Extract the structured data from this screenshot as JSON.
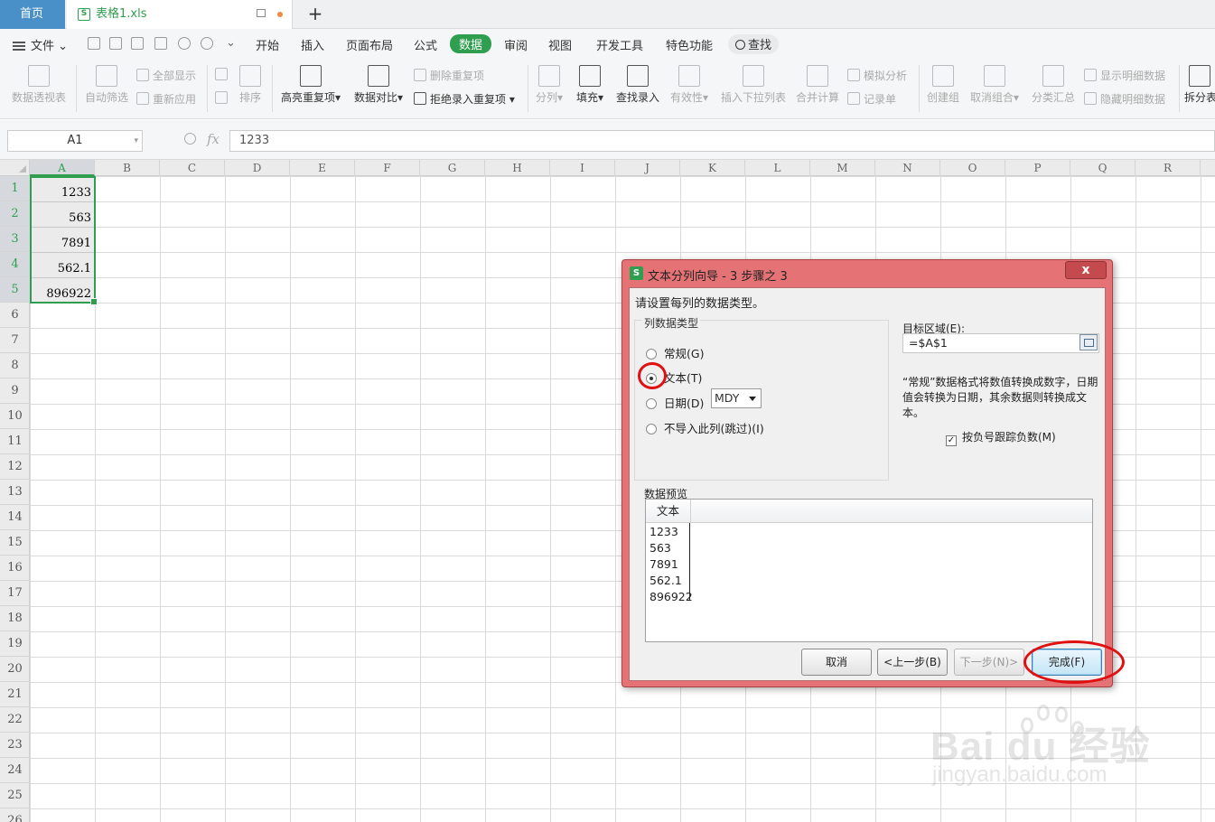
{
  "tabs": {
    "home": "首页",
    "doc": "表格1.xls",
    "add": "+"
  },
  "menu": {
    "file": "文件",
    "items": [
      "开始",
      "插入",
      "页面布局",
      "公式",
      "数据",
      "审阅",
      "视图",
      "开发工具",
      "特色功能"
    ],
    "active": "数据",
    "search": "查找"
  },
  "ribbon": {
    "pivot": "数据透视表",
    "autofilter": "自动筛选",
    "show_all": "全部显示",
    "reapply": "重新应用",
    "sort": "排序",
    "highlight_dup": "高亮重复项",
    "compare": "数据对比",
    "remove_dup": "删除重复项",
    "reject_dup": "拒绝录入重复项",
    "split": "分列",
    "fill": "填充",
    "lookup": "查找录入",
    "validity": "有效性",
    "dropdown": "插入下拉列表",
    "consolidate": "合并计算",
    "simulate": "模拟分析",
    "record": "记录单",
    "group": "创建组",
    "ungroup": "取消组合",
    "subtotal": "分类汇总",
    "show_detail": "显示明细数据",
    "hide_detail": "隐藏明细数据",
    "split_table": "拆分表"
  },
  "formula_bar": {
    "cell_ref": "A1",
    "fx": "fx",
    "value": "1233"
  },
  "sheet": {
    "columns": [
      "A",
      "B",
      "C",
      "D",
      "E",
      "F",
      "G",
      "H",
      "I",
      "J",
      "K",
      "L",
      "M",
      "N",
      "O",
      "P",
      "Q",
      "R"
    ],
    "rows": [
      "1",
      "2",
      "3",
      "4",
      "5",
      "6",
      "7",
      "8",
      "9",
      "10",
      "11",
      "12",
      "13",
      "14",
      "15",
      "16",
      "17",
      "18",
      "19",
      "20",
      "21",
      "22",
      "23",
      "24",
      "25",
      "26"
    ],
    "cells_A": [
      "1233",
      "563",
      "7891",
      "562.1",
      "896922"
    ]
  },
  "dialog": {
    "title": "文本分列向导 - 3 步骤之 3",
    "close": "x",
    "prompt": "请设置每列的数据类型。",
    "group_title": "列数据类型",
    "options": {
      "general": "常规(G)",
      "text": "文本(T)",
      "date": "日期(D)",
      "skip": "不导入此列(跳过)(I)"
    },
    "selected_option": "text",
    "date_format": "MDY",
    "target_label": "目标区域(E):",
    "target_value": "=$A$1",
    "description": "“常规”数据格式将数值转换成数字，日期值会转换为日期，其余数据则转换成文本。",
    "checkbox_label": "按负号跟踪负数(M)",
    "checkbox_checked": true,
    "preview_title": "数据预览",
    "preview_header": "文本",
    "preview_values": [
      "1233",
      "563",
      "7891",
      "562.1",
      "896922"
    ],
    "buttons": {
      "cancel": "取消",
      "back": "<上一步(B)",
      "next": "下一步(N)>",
      "finish": "完成(F)"
    }
  },
  "watermark": {
    "brand": "Bai du 经验",
    "site": "jingyan.baidu.com"
  }
}
